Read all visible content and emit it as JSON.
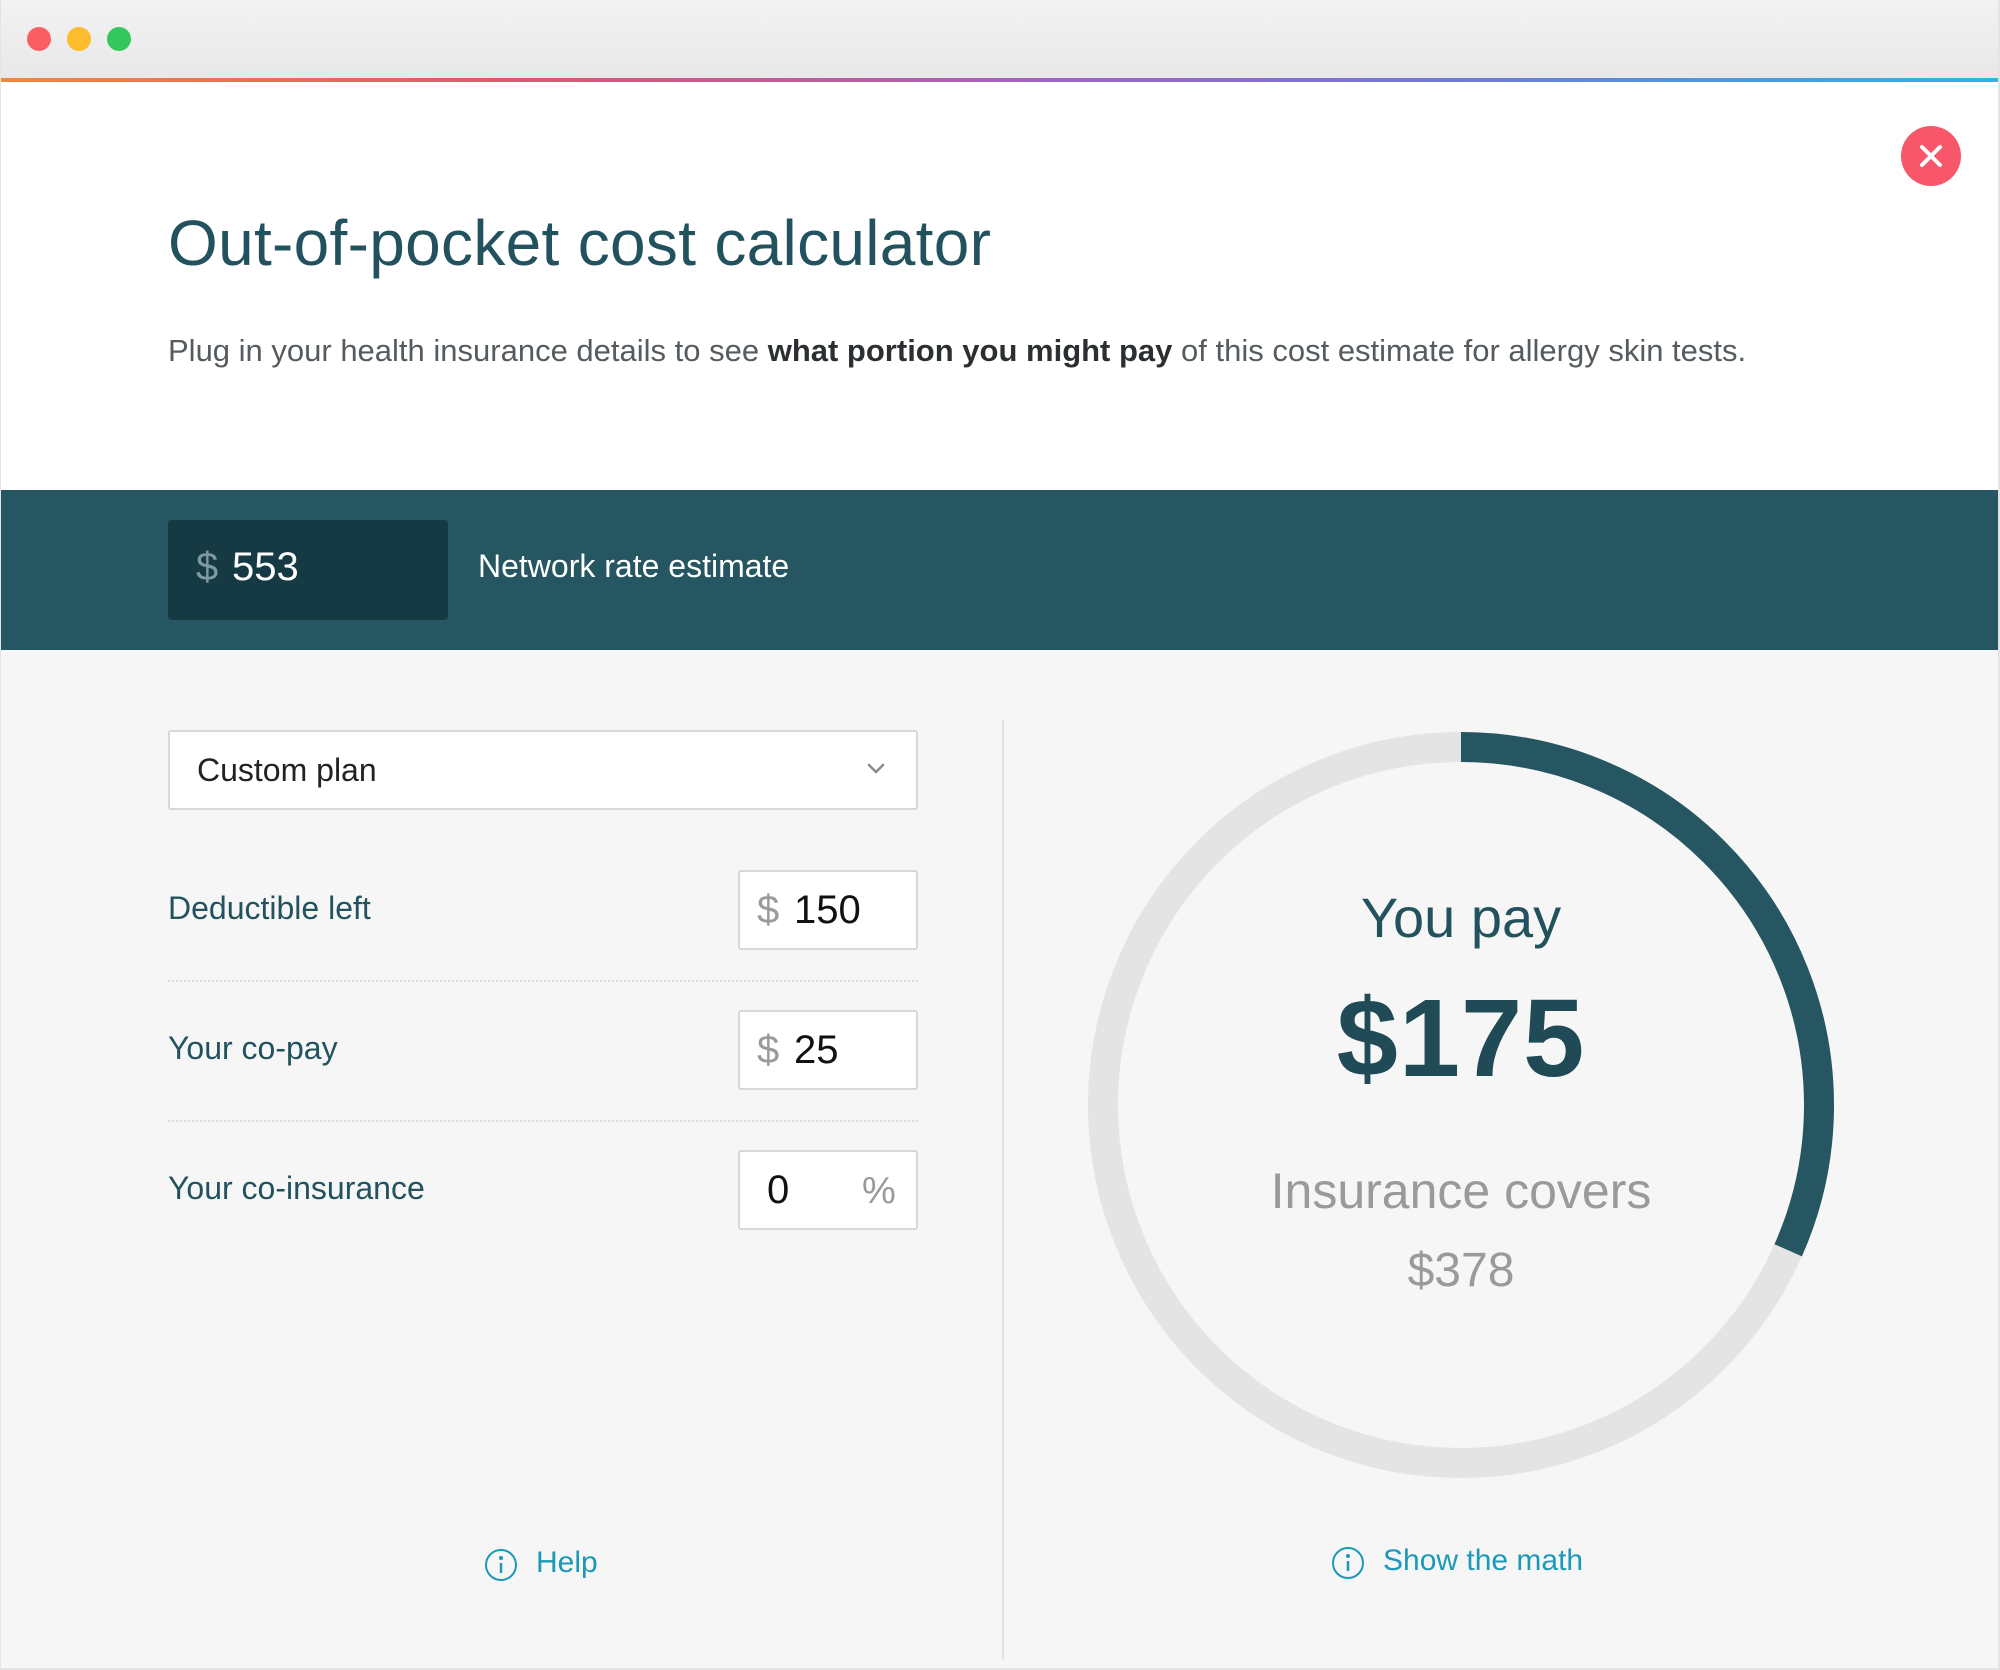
{
  "colors": {
    "accent": "#255661",
    "accent_dark": "#163a44",
    "title": "#23525f",
    "link": "#1c98b8",
    "close": "#f8566a",
    "ring_track": "#e4e4e4",
    "ring_fill": "#255661"
  },
  "header": {
    "title": "Out-of-pocket cost calculator",
    "subtitle_pre": "Plug in your health insurance details to see ",
    "subtitle_bold": "what portion you might pay",
    "subtitle_post": " of this cost estimate for allergy skin tests."
  },
  "network": {
    "currency": "$",
    "value": "553",
    "label": "Network rate estimate"
  },
  "plan": {
    "selected": "Custom plan",
    "icon": "chevron-down-icon"
  },
  "fields": {
    "deductible": {
      "label": "Deductible left",
      "prefix": "$",
      "value": "150"
    },
    "copay": {
      "label": "Your co-pay",
      "prefix": "$",
      "value": "25"
    },
    "coinsurance": {
      "label": "Your co-insurance",
      "value": "0",
      "suffix": "%"
    }
  },
  "result": {
    "you_pay_label": "You pay",
    "you_pay_amount": "$175",
    "covers_label": "Insurance covers",
    "covers_amount": "$378",
    "pay_fraction": 0.3165
  },
  "links": {
    "help": "Help",
    "show_math": "Show the math"
  }
}
